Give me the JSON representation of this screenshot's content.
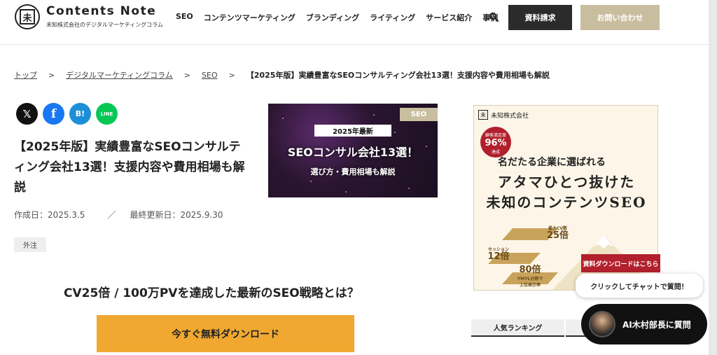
{
  "header": {
    "logo_mark": "未",
    "logo_title": "Contents Note",
    "logo_sub": "未知株式会社のデジタルマーケティングコラム",
    "nav": [
      "SEO",
      "コンテンツマーケティング",
      "ブランディング",
      "ライティング",
      "サービス紹介",
      "事例"
    ],
    "search_icon": "search-icon",
    "doc_request": "資料請求",
    "contact": "お問い合わせ"
  },
  "breadcrumb": {
    "top": "トップ",
    "column": "デジタルマーケティングコラム",
    "seo": "SEO",
    "current": "【2025年版】実績豊富なSEOコンサルティング会社13選！支援内容や費用相場も解説",
    "separator": ">"
  },
  "share": {
    "x": "𝕏",
    "facebook": "f",
    "hatena": "B!",
    "line": "LINE"
  },
  "article": {
    "title": "【2025年版】実績豊富なSEOコンサルティング会社13選！支援内容や費用相場も解説",
    "created": "作成日：2025.3.5",
    "divider": "／",
    "updated": "最終更新日：2025.9.30",
    "tag": "外注"
  },
  "hero": {
    "badge": "SEO",
    "year": "2025年最新",
    "main": "SEOコンサル会社13選！",
    "sub": "選び方・費用相場も解説"
  },
  "banner": {
    "company": "未知株式会社",
    "company_mark": "未",
    "badge_top": "顧客満足度",
    "badge_value": "96%",
    "badge_bottom": "達成",
    "headline1": "名だたる企業に選ばれる",
    "headline2": "アタマひとつ抜けた",
    "headline3": "未知のコンテンツSEO",
    "stat1_label": "最大CV数",
    "stat1_value": "25倍",
    "stat2_label": "セッション",
    "stat2_value": "12倍",
    "stat3_label": "YMYL分野で",
    "stat3_value": "80倍",
    "stat3_note": "上位表示率",
    "cta": "資料ダウンロードはこちら"
  },
  "promo": {
    "heading": "CV25倍 / 100万PVを達成した最新のSEO戦略とは？",
    "button": "今すぐ無料ダウンロード"
  },
  "sidebar": {
    "tab_ranking": "人気ランキング"
  },
  "chat": {
    "prompt": "クリックしてチャットで質問！",
    "button": "AI木村部長に質問"
  },
  "colors": {
    "dark": "#2b2b2b",
    "gold": "#c8bd9f",
    "orange": "#f0a830",
    "red": "#b1202c"
  }
}
